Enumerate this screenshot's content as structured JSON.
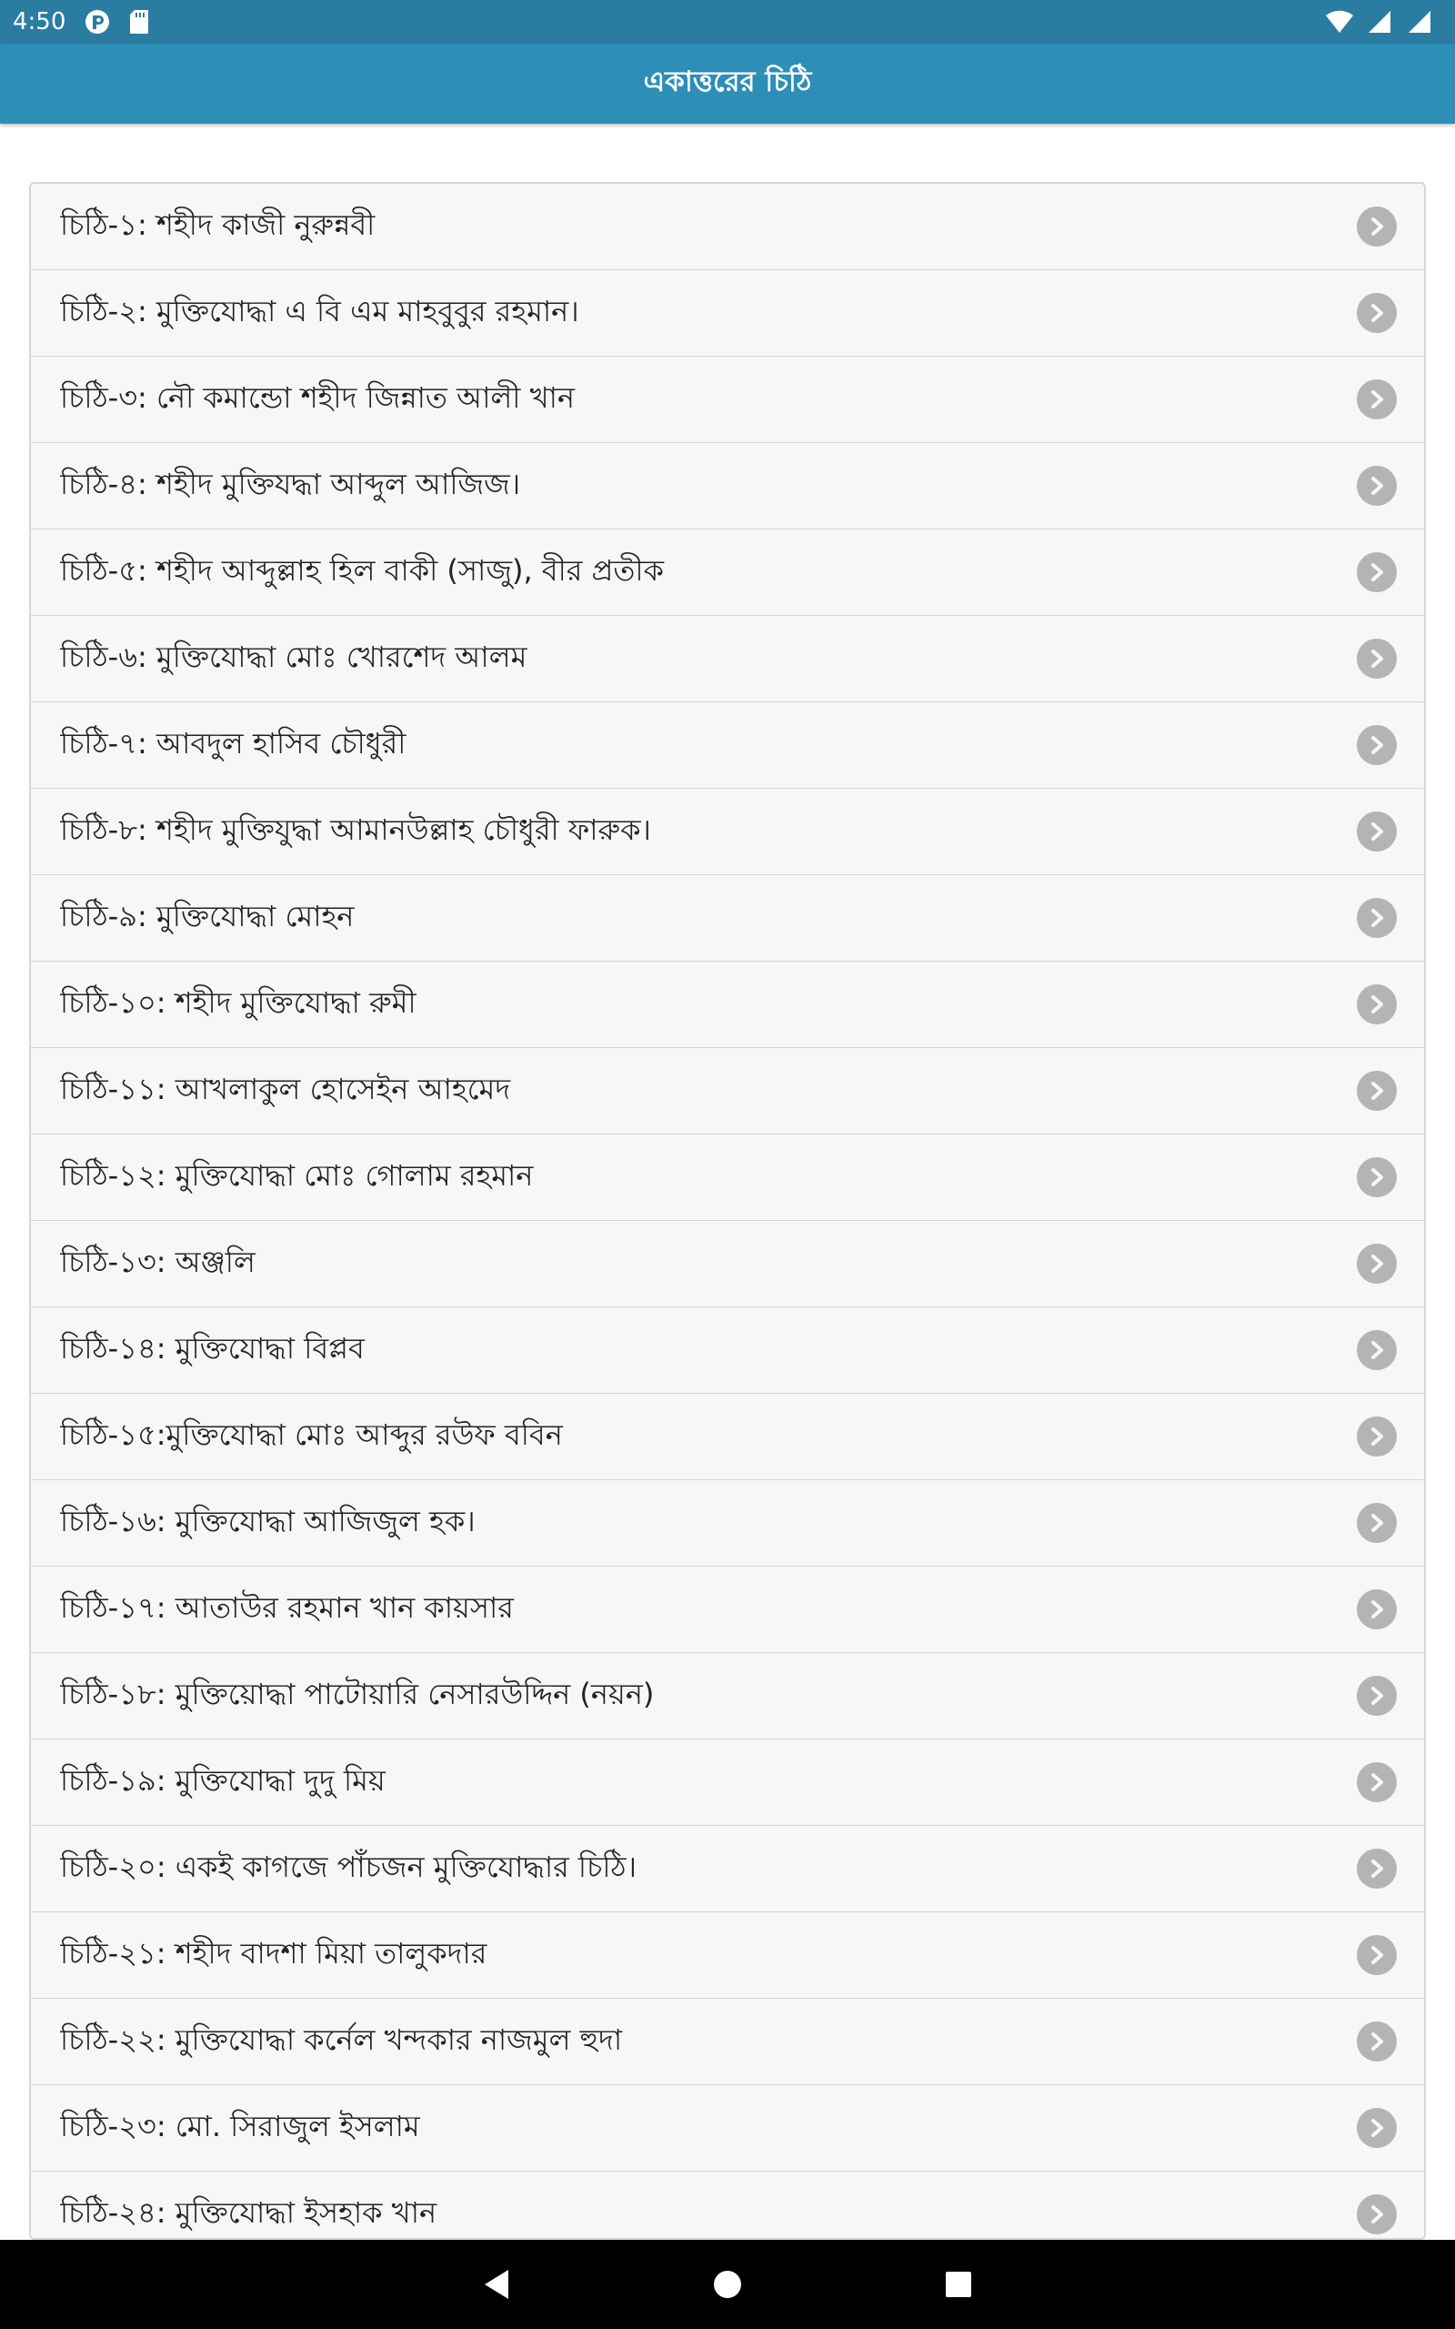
{
  "status_bar": {
    "time": "4:50",
    "icons": [
      "pocket-icon",
      "sd-card-icon",
      "wifi-icon",
      "signal-icon",
      "battery-icon"
    ]
  },
  "app_bar": {
    "title": "একাত্তরের চিঠি"
  },
  "list": {
    "items": [
      {
        "label": "চিঠি-১: শহীদ কাজী নুরুন্নবী"
      },
      {
        "label": "চিঠি-২: মুক্তিযোদ্ধা এ বি এম মাহবুবুর রহমান।"
      },
      {
        "label": "চিঠি-৩: নৌ কমান্ডো শহীদ জিন্নাত আলী খান"
      },
      {
        "label": "চিঠি-৪: শহীদ মুক্তিযদ্ধা আব্দুল আজিজ।"
      },
      {
        "label": "চিঠি-৫: শহীদ আব্দুল্লাহ হিল বাকী (সাজু), বীর প্রতীক"
      },
      {
        "label": "চিঠি-৬: মুক্তিযোদ্ধা মোঃ খোরশেদ আলম"
      },
      {
        "label": "চিঠি-৭: আবদুল হাসিব চৌধুরী"
      },
      {
        "label": "চিঠি-৮: শহীদ মুক্তিযুদ্ধা আমানউল্লাহ চৌধুরী ফারুক।"
      },
      {
        "label": "চিঠি-৯: মুক্তিযোদ্ধা মোহন"
      },
      {
        "label": "চিঠি-১০: শহীদ মুক্তিযোদ্ধা রুমী"
      },
      {
        "label": "চিঠি-১১: আখলাকুল হোসেইন আহমেদ"
      },
      {
        "label": "চিঠি-১২: মুক্তিযোদ্ধা মোঃ গোলাম রহমান"
      },
      {
        "label": "চিঠি-১৩: অঞ্জলি"
      },
      {
        "label": "চিঠি-১৪: মুক্তিযোদ্ধা বিপ্লব"
      },
      {
        "label": "চিঠি-১৫:মুক্তিযোদ্ধা মোঃ আব্দুর রউফ ববিন"
      },
      {
        "label": "চিঠি-১৬: মুক্তিযোদ্ধা আজিজুল হক।"
      },
      {
        "label": "চিঠি-১৭: আতাউর রহমান খান কায়সার"
      },
      {
        "label": "চিঠি-১৮: মুক্তিয়োদ্ধা পাটোয়ারি নেসারউদ্দিন (নয়ন)"
      },
      {
        "label": "চিঠি-১৯: মুক্তিযোদ্ধা দুদু মিয়"
      },
      {
        "label": "চিঠি-২০: একই কাগজে পাঁচজন মুক্তিযোদ্ধার চিঠি।"
      },
      {
        "label": "চিঠি-২১: শহীদ বাদশা মিয়া তালুকদার"
      },
      {
        "label": "চিঠি-২২: মুক্তিযোদ্ধা কর্নেল খন্দকার নাজমুল হুদা"
      },
      {
        "label": "চিঠি-২৩: মো. সিরাজুল ইসলাম"
      },
      {
        "label": "চিঠি-২৪: মুক্তিযোদ্ধা ইসহাক খান"
      }
    ],
    "item_icon": "chevron-right-icon"
  },
  "nav_bar": {
    "buttons": [
      "back-icon",
      "home-icon",
      "recents-icon"
    ]
  },
  "colors": {
    "status_bar": "#2a7ca1",
    "app_bar": "#2d8eb7",
    "list_bg": "#f7f7f7",
    "chevron": "#b4b4b4"
  }
}
